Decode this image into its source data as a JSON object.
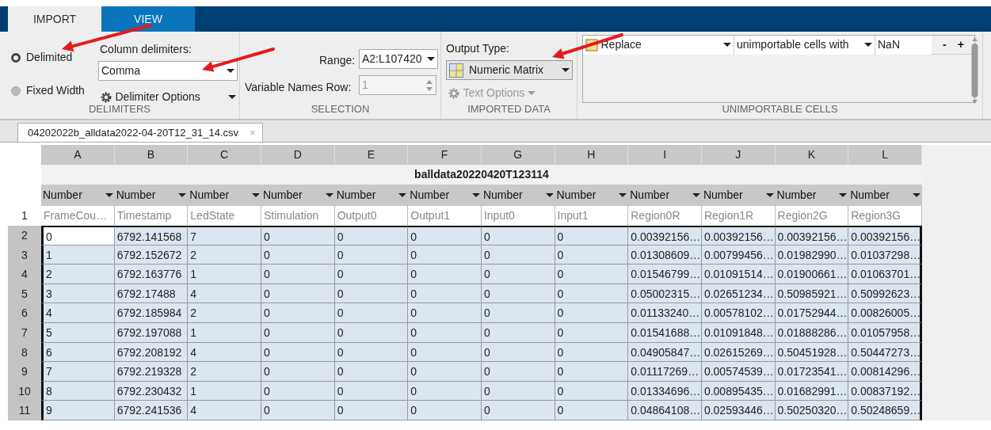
{
  "tabs": [
    {
      "label": "IMPORT",
      "selected": true
    },
    {
      "label": "VIEW",
      "selected": false
    }
  ],
  "delimiters": {
    "options": [
      {
        "label": "Delimited",
        "selected": true
      },
      {
        "label": "Fixed Width",
        "selected": false
      }
    ],
    "column_delimiters_label": "Column delimiters:",
    "column_delimiter": "Comma",
    "delimiter_options": "Delimiter Options",
    "section_label": "DELIMITERS"
  },
  "selection": {
    "range_label": "Range:",
    "range": "A2:L107420",
    "variable_names_label": "Variable Names Row:",
    "variable_names_row": {
      "value": "1",
      "disabled": true
    },
    "section_label": "SELECTION"
  },
  "imported_data": {
    "output_type_label": "Output Type:",
    "output_type": "Numeric Matrix",
    "text_options": {
      "label": "Text Options",
      "disabled": true
    },
    "section_label": "IMPORTED DATA"
  },
  "unimportable_cells": {
    "rule": {
      "action": "Replace",
      "target": "unimportable cells with",
      "value": "NaN"
    },
    "remove": "-",
    "add": "+",
    "section_label": "UNIMPORTABLE CELLS"
  },
  "document_tab": {
    "label": "04202022b_alldata2022-04-20T12_31_14.csv",
    "close": "×"
  },
  "table": {
    "title": "balldata20220420T123114",
    "header_row": "1",
    "columns": [
      {
        "letter": "A",
        "type": "Number",
        "name": "FrameCou…",
        "active": true
      },
      {
        "letter": "B",
        "type": "Number",
        "name": "Timestamp"
      },
      {
        "letter": "C",
        "type": "Number",
        "name": "LedState"
      },
      {
        "letter": "D",
        "type": "Number",
        "name": "Stimulation"
      },
      {
        "letter": "E",
        "type": "Number",
        "name": "Output0"
      },
      {
        "letter": "F",
        "type": "Number",
        "name": "Output1"
      },
      {
        "letter": "G",
        "type": "Number",
        "name": "Input0"
      },
      {
        "letter": "H",
        "type": "Number",
        "name": "Input1"
      },
      {
        "letter": "I",
        "type": "Number",
        "name": "Region0R"
      },
      {
        "letter": "J",
        "type": "Number",
        "name": "Region1R"
      },
      {
        "letter": "K",
        "type": "Number",
        "name": "Region2G"
      },
      {
        "letter": "L",
        "type": "Number",
        "name": "Region3G"
      }
    ],
    "rows": [
      {
        "number": "2",
        "selected": true,
        "active": true,
        "cells": [
          "0",
          "6792.141568",
          "7",
          "0",
          "0",
          "0",
          "0",
          "0",
          "0.00392156…",
          "0.00392156…",
          "0.00392156…",
          "0.00392156…"
        ]
      },
      {
        "number": "3",
        "selected": true,
        "cells": [
          "1",
          "6792.152672",
          "2",
          "0",
          "0",
          "0",
          "0",
          "0",
          "0.01308609…",
          "0.00799456…",
          "0.01982990…",
          "0.01037298…"
        ]
      },
      {
        "number": "4",
        "selected": true,
        "cells": [
          "2",
          "6792.163776",
          "1",
          "0",
          "0",
          "0",
          "0",
          "0",
          "0.01546799…",
          "0.01091514…",
          "0.01900661…",
          "0.01063701…"
        ]
      },
      {
        "number": "5",
        "selected": true,
        "cells": [
          "3",
          "6792.17488",
          "4",
          "0",
          "0",
          "0",
          "0",
          "0",
          "0.05002315…",
          "0.02651234…",
          "0.50985921…",
          "0.50992623…"
        ]
      },
      {
        "number": "6",
        "selected": true,
        "cells": [
          "4",
          "6792.185984",
          "2",
          "0",
          "0",
          "0",
          "0",
          "0",
          "0.01133240…",
          "0.00578102…",
          "0.01752944…",
          "0.00826005…"
        ]
      },
      {
        "number": "7",
        "selected": true,
        "cells": [
          "5",
          "6792.197088",
          "1",
          "0",
          "0",
          "0",
          "0",
          "0",
          "0.01541688…",
          "0.01091848…",
          "0.01888286…",
          "0.01057958…"
        ]
      },
      {
        "number": "8",
        "selected": true,
        "cells": [
          "6",
          "6792.208192",
          "4",
          "0",
          "0",
          "0",
          "0",
          "0",
          "0.04905847…",
          "0.02615269…",
          "0.50451928…",
          "0.50447273…"
        ]
      },
      {
        "number": "9",
        "selected": true,
        "cells": [
          "7",
          "6792.219328",
          "2",
          "0",
          "0",
          "0",
          "0",
          "0",
          "0.01117269…",
          "0.00574539…",
          "0.01723541…",
          "0.00814296…"
        ]
      },
      {
        "number": "10",
        "selected": true,
        "cells": [
          "8",
          "6792.230432",
          "1",
          "0",
          "0",
          "0",
          "0",
          "0",
          "0.01334696…",
          "0.00895435…",
          "0.01682991…",
          "0.00837192…"
        ]
      },
      {
        "number": "11",
        "selected": true,
        "cells": [
          "9",
          "6792.241536",
          "4",
          "0",
          "0",
          "0",
          "0",
          "0",
          "0.04864108…",
          "0.02593446…",
          "0.50250320…",
          "0.50248659…"
        ]
      }
    ]
  },
  "annotations": [
    {
      "kind": "arrow"
    },
    {
      "kind": "arrow"
    },
    {
      "kind": "arrow"
    }
  ]
}
